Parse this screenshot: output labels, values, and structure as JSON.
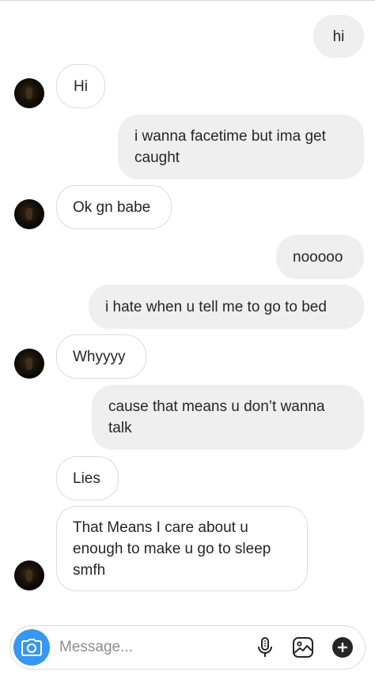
{
  "messages": [
    {
      "side": "out",
      "text": "hi"
    },
    {
      "side": "in",
      "text": "Hi"
    },
    {
      "side": "out",
      "text": "i wanna facetime but ima get caught"
    },
    {
      "side": "in",
      "text": "Ok gn babe"
    },
    {
      "side": "out",
      "text": "nooooo"
    },
    {
      "side": "out",
      "text": "i hate when u tell me to go to bed"
    },
    {
      "side": "in",
      "text": "Whyyyy"
    },
    {
      "side": "out",
      "text": "cause that means u don’t wanna talk"
    },
    {
      "side": "in",
      "text": "Lies"
    },
    {
      "side": "in",
      "text": "That Means I care about u enough to make u go to sleep smfh"
    }
  ],
  "composer": {
    "placeholder": "Message...",
    "camera_icon": "camera-icon",
    "microphone_icon": "microphone-icon",
    "gallery_icon": "gallery-icon",
    "add_icon": "plus-icon"
  },
  "colors": {
    "outgoing_bubble": "#efefef",
    "incoming_border": "#dbdbdb",
    "camera_button": "#3897f0",
    "text": "#262626",
    "placeholder": "#8e8e8e"
  }
}
